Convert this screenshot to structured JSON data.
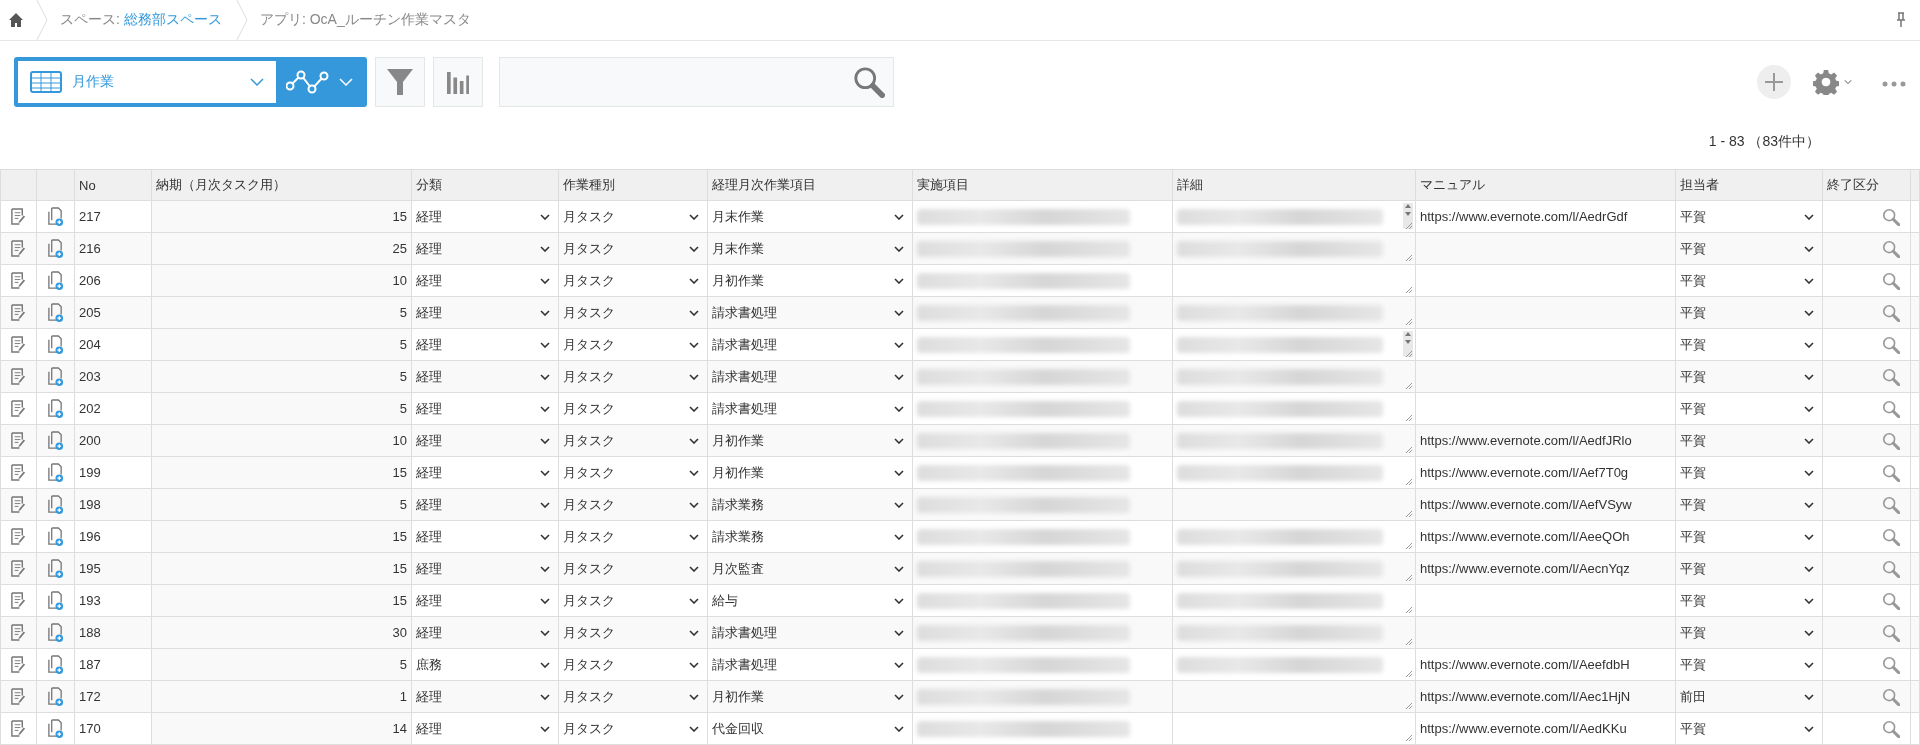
{
  "breadcrumbs": [
    {
      "label": "スペース:",
      "link": "総務部スペース"
    },
    {
      "label": "アプリ: OcA_ルーチン作業マスタ"
    }
  ],
  "view": {
    "name": "月作業"
  },
  "count": "1 - 83 （83件中）",
  "table": {
    "columns": [
      "No",
      "納期（月次タスク用）",
      "分類",
      "作業種別",
      "経理月次作業項目",
      "実施項目",
      "詳細",
      "マニュアル",
      "担当者",
      "終了区分"
    ],
    "rows": [
      {
        "no": "217",
        "due": "15",
        "category": "経理",
        "type": "月タスク",
        "item": "月末作業",
        "task_redacted": true,
        "detail_redacted": true,
        "detail_scrollbar": true,
        "manual": "https://www.evernote.com/l/AedrGdf",
        "owner": "平賀"
      },
      {
        "no": "216",
        "due": "25",
        "category": "経理",
        "type": "月タスク",
        "item": "月末作業",
        "task_redacted": true,
        "detail_redacted": true,
        "detail_scrollbar": false,
        "owner": "平賀"
      },
      {
        "no": "206",
        "due": "10",
        "category": "経理",
        "type": "月タスク",
        "item": "月初作業",
        "task_redacted": true,
        "detail_redacted": false,
        "detail_scrollbar": false,
        "owner": "平賀"
      },
      {
        "no": "205",
        "due": "5",
        "category": "経理",
        "type": "月タスク",
        "item": "請求書処理",
        "task_redacted": true,
        "detail_redacted": true,
        "detail_scrollbar": false,
        "owner": "平賀"
      },
      {
        "no": "204",
        "due": "5",
        "category": "経理",
        "type": "月タスク",
        "item": "請求書処理",
        "task_redacted": true,
        "detail_redacted": true,
        "detail_scrollbar": true,
        "owner": "平賀"
      },
      {
        "no": "203",
        "due": "5",
        "category": "経理",
        "type": "月タスク",
        "item": "請求書処理",
        "task_redacted": true,
        "detail_redacted": true,
        "detail_scrollbar": false,
        "owner": "平賀"
      },
      {
        "no": "202",
        "due": "5",
        "category": "経理",
        "type": "月タスク",
        "item": "請求書処理",
        "task_redacted": true,
        "detail_redacted": true,
        "detail_scrollbar": false,
        "owner": "平賀"
      },
      {
        "no": "200",
        "due": "10",
        "category": "経理",
        "type": "月タスク",
        "item": "月初作業",
        "task_redacted": true,
        "detail_redacted": true,
        "detail_scrollbar": false,
        "manual": "https://www.evernote.com/l/AedfJRlo",
        "owner": "平賀"
      },
      {
        "no": "199",
        "due": "15",
        "category": "経理",
        "type": "月タスク",
        "item": "月初作業",
        "task_redacted": true,
        "detail_redacted": true,
        "detail_scrollbar": false,
        "manual": "https://www.evernote.com/l/Aef7T0g",
        "owner": "平賀"
      },
      {
        "no": "198",
        "due": "5",
        "category": "経理",
        "type": "月タスク",
        "item": "請求業務",
        "task_redacted": true,
        "detail_redacted": false,
        "detail_scrollbar": false,
        "manual": "https://www.evernote.com/l/AefVSyw",
        "owner": "平賀"
      },
      {
        "no": "196",
        "due": "15",
        "category": "経理",
        "type": "月タスク",
        "item": "請求業務",
        "task_redacted": true,
        "detail_redacted": true,
        "detail_scrollbar": false,
        "manual": "https://www.evernote.com/l/AeeQOh",
        "owner": "平賀"
      },
      {
        "no": "195",
        "due": "15",
        "category": "経理",
        "type": "月タスク",
        "item": "月次監査",
        "task_redacted": true,
        "detail_redacted": true,
        "detail_scrollbar": false,
        "manual": "https://www.evernote.com/l/AecnYqz",
        "owner": "平賀"
      },
      {
        "no": "193",
        "due": "15",
        "category": "経理",
        "type": "月タスク",
        "item": "給与",
        "task_redacted": true,
        "detail_redacted": true,
        "detail_scrollbar": false,
        "owner": "平賀"
      },
      {
        "no": "188",
        "due": "30",
        "category": "経理",
        "type": "月タスク",
        "item": "請求書処理",
        "task_redacted": true,
        "detail_redacted": true,
        "detail_scrollbar": false,
        "owner": "平賀"
      },
      {
        "no": "187",
        "due": "5",
        "category": "庶務",
        "type": "月タスク",
        "item": "請求書処理",
        "task_redacted": true,
        "detail_redacted": true,
        "detail_scrollbar": false,
        "manual": "https://www.evernote.com/l/AeefdbH",
        "owner": "平賀"
      },
      {
        "no": "172",
        "due": "1",
        "category": "経理",
        "type": "月タスク",
        "item": "月初作業",
        "task_redacted": true,
        "detail_redacted": false,
        "detail_scrollbar": false,
        "manual": "https://www.evernote.com/l/Aec1HjN",
        "owner": "前田"
      },
      {
        "no": "170",
        "due": "14",
        "category": "経理",
        "type": "月タスク",
        "item": "代金回収",
        "task_redacted": true,
        "detail_redacted": false,
        "detail_scrollbar": false,
        "manual": "https://www.evernote.com/l/AedKKu",
        "owner": "平賀"
      }
    ]
  }
}
